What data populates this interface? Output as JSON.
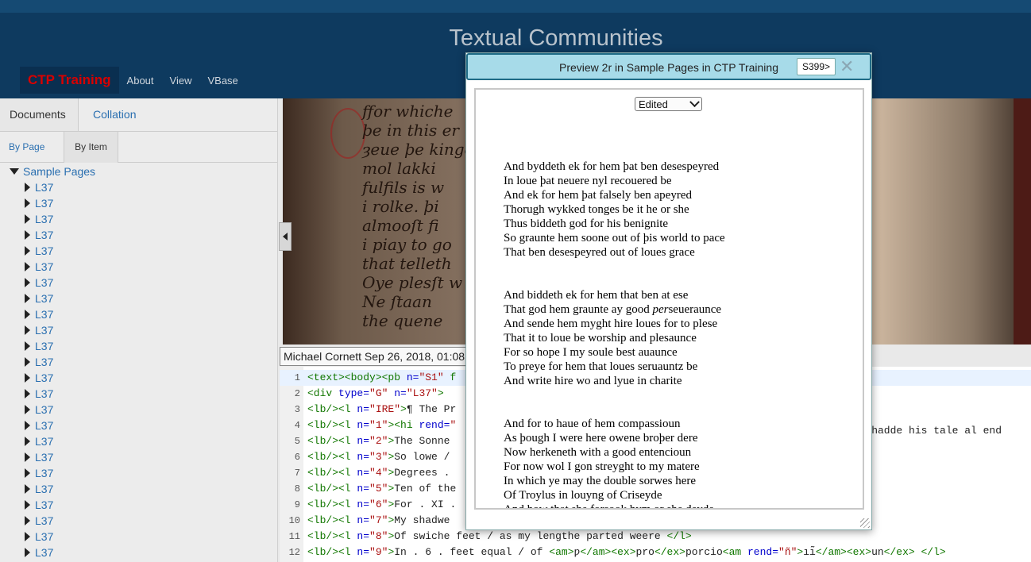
{
  "header": {
    "title": "Textual Communities",
    "brand": "CTP Training",
    "nav": [
      "About",
      "View",
      "VBase"
    ]
  },
  "left": {
    "tabs": [
      "Documents",
      "Collation"
    ],
    "subtabs": [
      "By Page",
      "By Item"
    ],
    "tree_root": "Sample Pages",
    "items": [
      "L37",
      "L37",
      "L37",
      "L37",
      "L37",
      "L37",
      "L37",
      "L37",
      "L37",
      "L37",
      "L37",
      "L37",
      "L37",
      "L37",
      "L37",
      "L37",
      "L37",
      "L37",
      "L37",
      "L37",
      "L37",
      "L37",
      "L37",
      "L37"
    ]
  },
  "revision": "Michael Cornett Sep 26, 2018, 01:08",
  "editor_lines": [
    {
      "n": "1",
      "parts": [
        [
          "tg",
          "<text><body><pb "
        ],
        [
          "at",
          "n="
        ],
        [
          "st",
          "\"S1\""
        ],
        [
          "tg",
          " f"
        ]
      ]
    },
    {
      "n": "2",
      "parts": [
        [
          "tg",
          "<div "
        ],
        [
          "at",
          "type="
        ],
        [
          "st",
          "\"G\""
        ],
        [
          "at",
          " n="
        ],
        [
          "st",
          "\"L37\""
        ],
        [
          "tg",
          ">"
        ]
      ]
    },
    {
      "n": "3",
      "parts": [
        [
          "tg",
          "<lb/><l "
        ],
        [
          "at",
          "n="
        ],
        [
          "st",
          "\"IRE\""
        ],
        [
          "tg",
          ">"
        ],
        [
          "",
          "¶ The Pr"
        ]
      ]
    },
    {
      "n": "4",
      "parts": [
        [
          "tg",
          "<lb/><l "
        ],
        [
          "at",
          "n="
        ],
        [
          "st",
          "\"1\""
        ],
        [
          "tg",
          "><hi "
        ],
        [
          "at",
          "rend="
        ],
        [
          "st",
          "\""
        ]
      ]
    },
    {
      "n": "5",
      "parts": [
        [
          "tg",
          "<lb/><l "
        ],
        [
          "at",
          "n="
        ],
        [
          "st",
          "\"2\""
        ],
        [
          "tg",
          ">"
        ],
        [
          "",
          "The Sonne"
        ]
      ]
    },
    {
      "n": "6",
      "parts": [
        [
          "tg",
          "<lb/><l "
        ],
        [
          "at",
          "n="
        ],
        [
          "st",
          "\"3\""
        ],
        [
          "tg",
          ">"
        ],
        [
          "",
          "So lowe /"
        ]
      ]
    },
    {
      "n": "7",
      "parts": [
        [
          "tg",
          "<lb/><l "
        ],
        [
          "at",
          "n="
        ],
        [
          "st",
          "\"4\""
        ],
        [
          "tg",
          ">"
        ],
        [
          "",
          "Degrees ."
        ]
      ]
    },
    {
      "n": "8",
      "parts": [
        [
          "tg",
          "<lb/><l "
        ],
        [
          "at",
          "n="
        ],
        [
          "st",
          "\"5\""
        ],
        [
          "tg",
          ">"
        ],
        [
          "",
          "Ten of the"
        ]
      ]
    },
    {
      "n": "9",
      "parts": [
        [
          "tg",
          "<lb/><l "
        ],
        [
          "at",
          "n="
        ],
        [
          "st",
          "\"6\""
        ],
        [
          "tg",
          ">"
        ],
        [
          "",
          "For . XI ."
        ]
      ]
    },
    {
      "n": "10",
      "parts": [
        [
          "tg",
          "<lb/><l "
        ],
        [
          "at",
          "n="
        ],
        [
          "st",
          "\"7\""
        ],
        [
          "tg",
          ">"
        ],
        [
          "",
          "My shadwe"
        ]
      ]
    },
    {
      "n": "11",
      "parts": [
        [
          "tg",
          "<lb/><l "
        ],
        [
          "at",
          "n="
        ],
        [
          "st",
          "\"8\""
        ],
        [
          "tg",
          ">"
        ],
        [
          "",
          "Of swiche feet / as my lengthe parted weere "
        ],
        [
          "tg",
          "</l>"
        ]
      ]
    },
    {
      "n": "12",
      "parts": [
        [
          "tg",
          "<lb/><l "
        ],
        [
          "at",
          "n="
        ],
        [
          "st",
          "\"9\""
        ],
        [
          "tg",
          ">"
        ],
        [
          "",
          "In . 6 . feet equal / of "
        ],
        [
          "tg",
          "<am>"
        ],
        [
          "",
          "ƿ"
        ],
        [
          "tg",
          "</am><ex>"
        ],
        [
          "",
          "pro"
        ],
        [
          "tg",
          "</ex>"
        ],
        [
          "",
          "porcio"
        ],
        [
          "tg",
          "<am "
        ],
        [
          "at",
          "rend="
        ],
        [
          "st",
          "\"ñ\""
        ],
        [
          "tg",
          ">"
        ],
        [
          "",
          "ıı̃"
        ],
        [
          "tg",
          "</am><ex>"
        ],
        [
          "",
          "un"
        ],
        [
          "tg",
          "</ex> </l>"
        ]
      ]
    }
  ],
  "editor_right": "ple hadde his tale al end",
  "manuscript_text": "ffor whiche\nþe in this er\nȝeue þe kinge\nmol lakki\nfulfils is w\ni rolke. þi\nalmooſt fi\ni piay to go\nthat telleth\nOye plesſt w\nNe ſtaan\nthe quene",
  "modal": {
    "title": "Preview 2r in Sample Pages in CTP Training",
    "badge": "S399>",
    "close": "✕",
    "select": "Edited",
    "stanzas": [
      [
        "And byddeth ek for hem þat ben desespeyred",
        "In loue þat neuere nyl recouered be",
        "And ek for hem þat falsely ben apeyred",
        "Thorugh wykked tonges be it he or she",
        "Thus biddeth god for his benignite",
        "So graunte hem soone out of þis world to pace",
        "That ben desespeyred out of loues grace"
      ],
      [
        "And biddeth ek for hem that ben at ese",
        "That god hem graunte ay good |per|seueraunce",
        "And sende hem myght hire loues for to plese",
        "That it to loue be worship and plesaunce",
        "For so hope I my soule best auaunce",
        "To preye for hem that loues seruauntz be",
        "And write hire wo and lyue in charite"
      ],
      [
        "And for to haue of hem compassioun",
        "As þough I were here owene broþer dere",
        "Now herkeneth with a good entencioun",
        "For now wol I gon streyght to my matere",
        "In which ye may the double sorwes here",
        "Of Troylus in louyng of Criseyde",
        "And how that she forsook hym or she deyde"
      ]
    ]
  }
}
